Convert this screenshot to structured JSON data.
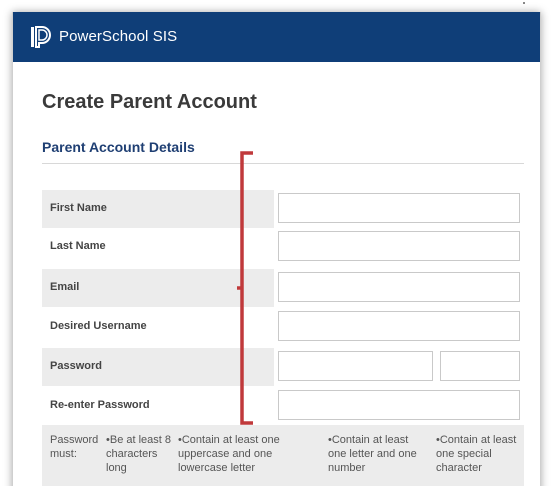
{
  "app": {
    "brand_name": "PowerSchool SIS",
    "logo_icon": "powerschool-logo-icon",
    "header_color": "#0f3e78"
  },
  "page": {
    "title": "Create Parent Account",
    "section_title": "Parent Account Details"
  },
  "form": {
    "fields": [
      {
        "label": "First Name",
        "value": "",
        "placeholder": ""
      },
      {
        "label": "Last Name",
        "value": "",
        "placeholder": ""
      },
      {
        "label": "Email",
        "value": "",
        "placeholder": ""
      },
      {
        "label": "Desired Username",
        "value": "",
        "placeholder": ""
      },
      {
        "label": "Password",
        "value": "",
        "placeholder": ""
      },
      {
        "label": "Re-enter Password",
        "value": "",
        "placeholder": ""
      }
    ],
    "password_rules": {
      "heading": "Password must:",
      "items": [
        "•Be at least 8 characters long",
        "•Contain at least one uppercase and one lowercase letter",
        "•Contain at least one letter and one number",
        "•Contain at least one special character"
      ]
    }
  },
  "annotation": {
    "bracket_color": "#c0393b"
  }
}
